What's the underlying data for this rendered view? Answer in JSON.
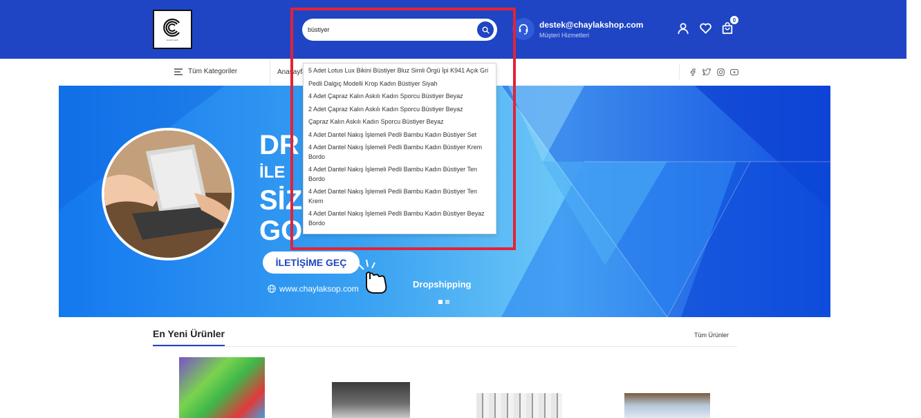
{
  "header": {
    "search": {
      "value": "büstiyer",
      "placeholder": ""
    },
    "support": {
      "email": "destek@chaylakshop.com",
      "subtitle": "Müşteri Hizmetleri"
    },
    "cart_count": "0"
  },
  "nav": {
    "all_categories": "Tüm Kategoriler",
    "link_partial": "Anasayfa"
  },
  "suggestions": [
    "5 Adet Lotus Lux Bikini Büstiyer Bluz Simli Örgü İpi K941 Açık Gri",
    "Pedli Dalgıç Modelli Krop Kadın Büstiyer Siyah",
    "4 Adet Çapraz Kalın Askılı Kadın Sporcu Büstiyer Beyaz",
    "2 Adet Çapraz Kalın Askılı Kadın Sporcu Büstiyer Beyaz",
    "Çapraz Kalın Askılı Kadın Sporcu Büstiyer Beyaz",
    "4 Adet Dantel Nakış İşlemeli Pedli Bambu Kadın Büstiyer Set",
    "4 Adet Dantel Nakış İşlemeli Pedli Bambu Kadın Büstiyer Krem Bordo",
    "4 Adet Dantel Nakış İşlemeli Pedli Bambu Kadın Büstiyer Ten Bordo",
    "4 Adet Dantel Nakış İşlemeli Pedli Bambu Kadın Büstiyer Ten Krem",
    "4 Adet Dantel Nakış İşlemeli Pedli Bambu Kadın Büstiyer Beyaz Bordo"
  ],
  "banner": {
    "headline_line1": "DR",
    "headline_line2": "İLE",
    "headline_line3": "SİZ",
    "headline_line4": "GO",
    "cta": "İLETİŞİME GEÇ",
    "url": "www.chaylaksop.com",
    "tag": "Dropshipping"
  },
  "products_section": {
    "title": "En Yeni Ürünler",
    "all_link": "Tüm Ürünler"
  },
  "colors": {
    "brand_blue": "#1f45c4",
    "highlight_red": "#e32236"
  }
}
